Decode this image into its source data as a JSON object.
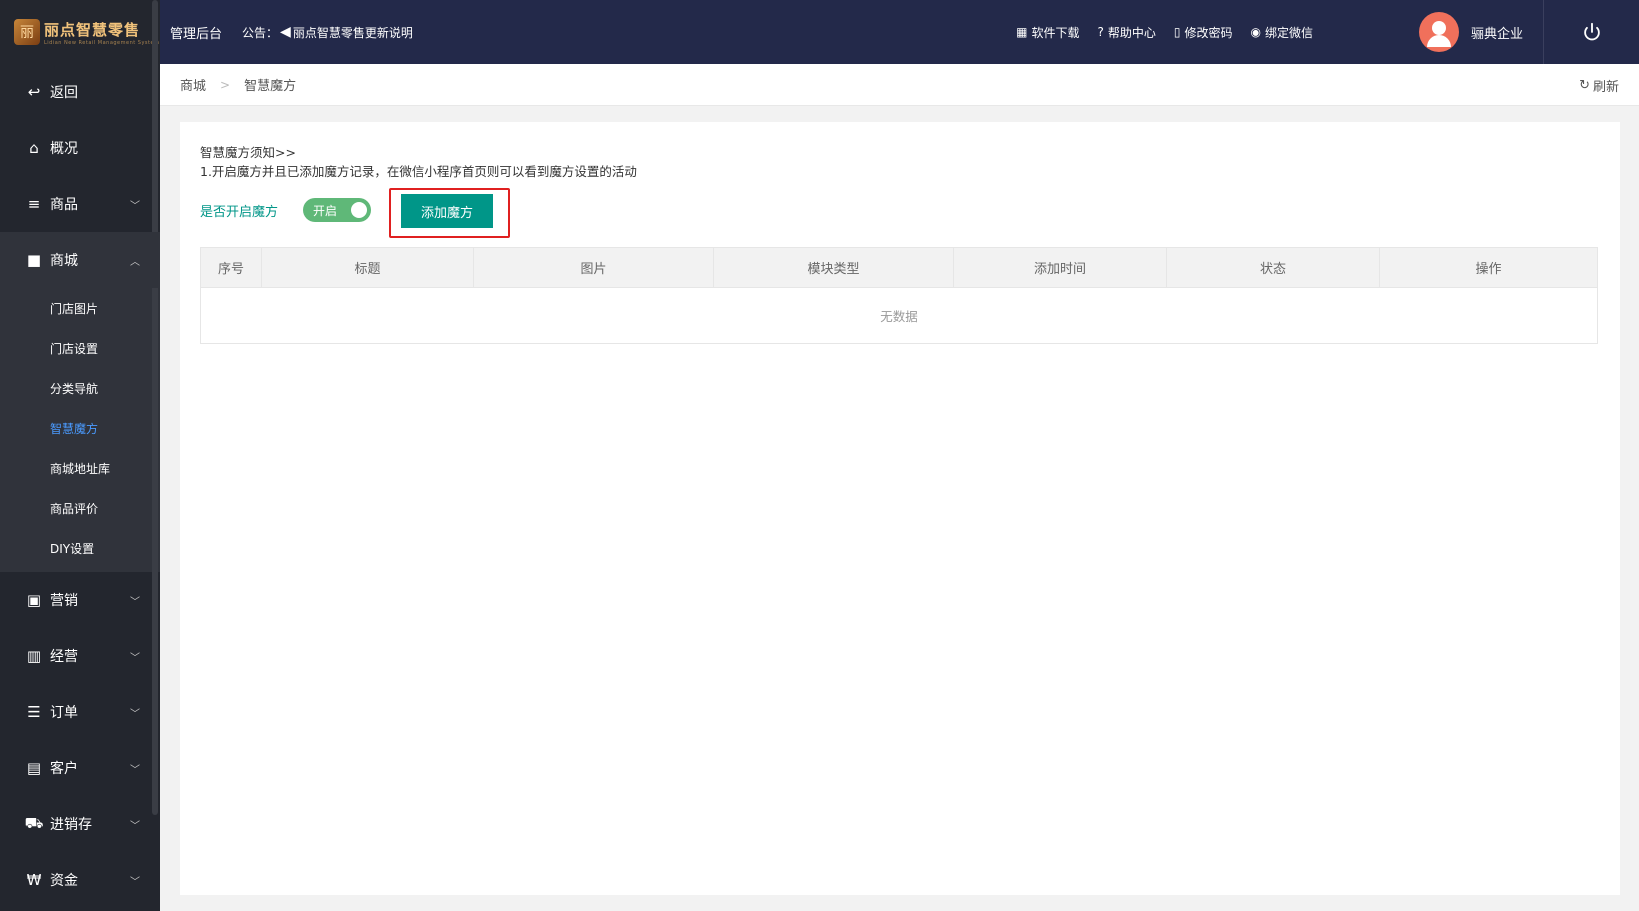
{
  "brand": {
    "name": "丽点智慧零售",
    "subtitle": "Lidian New Retail Management System"
  },
  "topbar": {
    "title": "管理后台",
    "notice_label": "公告：",
    "notice_text": "丽点智慧零售更新说明",
    "links": [
      {
        "icon": "store-icon",
        "label": "软件下载"
      },
      {
        "icon": "help-icon",
        "label": "帮助中心"
      },
      {
        "icon": "key-icon",
        "label": "修改密码"
      },
      {
        "icon": "wechat-icon",
        "label": "绑定微信"
      }
    ],
    "user": "骊典企业"
  },
  "sidebar": {
    "items": [
      {
        "icon": "back-icon",
        "label": "返回"
      },
      {
        "icon": "home-icon",
        "label": "概况"
      },
      {
        "icon": "list-icon",
        "label": "商品"
      },
      {
        "icon": "bag-icon",
        "label": "商城"
      }
    ],
    "submenu": [
      {
        "label": "门店图片"
      },
      {
        "label": "门店设置"
      },
      {
        "label": "分类导航"
      },
      {
        "label": "智慧魔方"
      },
      {
        "label": "商城地址库"
      },
      {
        "label": "商品评价"
      },
      {
        "label": "DIY设置"
      }
    ],
    "items_after": [
      {
        "icon": "gift-icon",
        "label": "营销"
      },
      {
        "icon": "chart-icon",
        "label": "经营"
      },
      {
        "icon": "list-icon",
        "label": "订单"
      },
      {
        "icon": "card-icon",
        "label": "客户"
      },
      {
        "icon": "truck-icon",
        "label": "进销存"
      },
      {
        "icon": "currency-icon",
        "label": "资金"
      }
    ]
  },
  "breadcrumb": {
    "parent": "商城",
    "current": "智慧魔方",
    "refresh": "刷新"
  },
  "main": {
    "notice_title": "智慧魔方须知>>",
    "notice_line": "1.开启魔方并且已添加魔方记录，在微信小程序首页则可以看到魔方设置的活动",
    "toggle_label": "是否开启魔方",
    "toggle_state": "开启",
    "add_button": "添加魔方",
    "table": {
      "columns": [
        "序号",
        "标题",
        "图片",
        "模块类型",
        "添加时间",
        "状态",
        "操作"
      ],
      "empty_text": "无数据"
    }
  },
  "colors": {
    "sidebar": "#23262e",
    "topbar": "#23294a",
    "primary": "#009688",
    "active_link": "#4a9bff",
    "highlight": "#e02020"
  }
}
